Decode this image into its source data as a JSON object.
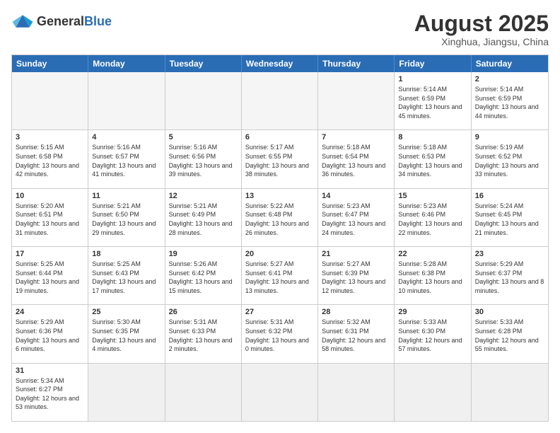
{
  "header": {
    "logo_general": "General",
    "logo_blue": "Blue",
    "month_year": "August 2025",
    "location": "Xinghua, Jiangsu, China"
  },
  "days_of_week": [
    "Sunday",
    "Monday",
    "Tuesday",
    "Wednesday",
    "Thursday",
    "Friday",
    "Saturday"
  ],
  "weeks": [
    [
      {
        "day": "",
        "info": "",
        "empty": true
      },
      {
        "day": "",
        "info": "",
        "empty": true
      },
      {
        "day": "",
        "info": "",
        "empty": true
      },
      {
        "day": "",
        "info": "",
        "empty": true
      },
      {
        "day": "",
        "info": "",
        "empty": true
      },
      {
        "day": "1",
        "info": "Sunrise: 5:14 AM\nSunset: 6:59 PM\nDaylight: 13 hours and 45 minutes.",
        "empty": false
      },
      {
        "day": "2",
        "info": "Sunrise: 5:14 AM\nSunset: 6:59 PM\nDaylight: 13 hours and 44 minutes.",
        "empty": false
      }
    ],
    [
      {
        "day": "3",
        "info": "Sunrise: 5:15 AM\nSunset: 6:58 PM\nDaylight: 13 hours and 42 minutes.",
        "empty": false
      },
      {
        "day": "4",
        "info": "Sunrise: 5:16 AM\nSunset: 6:57 PM\nDaylight: 13 hours and 41 minutes.",
        "empty": false
      },
      {
        "day": "5",
        "info": "Sunrise: 5:16 AM\nSunset: 6:56 PM\nDaylight: 13 hours and 39 minutes.",
        "empty": false
      },
      {
        "day": "6",
        "info": "Sunrise: 5:17 AM\nSunset: 6:55 PM\nDaylight: 13 hours and 38 minutes.",
        "empty": false
      },
      {
        "day": "7",
        "info": "Sunrise: 5:18 AM\nSunset: 6:54 PM\nDaylight: 13 hours and 36 minutes.",
        "empty": false
      },
      {
        "day": "8",
        "info": "Sunrise: 5:18 AM\nSunset: 6:53 PM\nDaylight: 13 hours and 34 minutes.",
        "empty": false
      },
      {
        "day": "9",
        "info": "Sunrise: 5:19 AM\nSunset: 6:52 PM\nDaylight: 13 hours and 33 minutes.",
        "empty": false
      }
    ],
    [
      {
        "day": "10",
        "info": "Sunrise: 5:20 AM\nSunset: 6:51 PM\nDaylight: 13 hours and 31 minutes.",
        "empty": false
      },
      {
        "day": "11",
        "info": "Sunrise: 5:21 AM\nSunset: 6:50 PM\nDaylight: 13 hours and 29 minutes.",
        "empty": false
      },
      {
        "day": "12",
        "info": "Sunrise: 5:21 AM\nSunset: 6:49 PM\nDaylight: 13 hours and 28 minutes.",
        "empty": false
      },
      {
        "day": "13",
        "info": "Sunrise: 5:22 AM\nSunset: 6:48 PM\nDaylight: 13 hours and 26 minutes.",
        "empty": false
      },
      {
        "day": "14",
        "info": "Sunrise: 5:23 AM\nSunset: 6:47 PM\nDaylight: 13 hours and 24 minutes.",
        "empty": false
      },
      {
        "day": "15",
        "info": "Sunrise: 5:23 AM\nSunset: 6:46 PM\nDaylight: 13 hours and 22 minutes.",
        "empty": false
      },
      {
        "day": "16",
        "info": "Sunrise: 5:24 AM\nSunset: 6:45 PM\nDaylight: 13 hours and 21 minutes.",
        "empty": false
      }
    ],
    [
      {
        "day": "17",
        "info": "Sunrise: 5:25 AM\nSunset: 6:44 PM\nDaylight: 13 hours and 19 minutes.",
        "empty": false
      },
      {
        "day": "18",
        "info": "Sunrise: 5:25 AM\nSunset: 6:43 PM\nDaylight: 13 hours and 17 minutes.",
        "empty": false
      },
      {
        "day": "19",
        "info": "Sunrise: 5:26 AM\nSunset: 6:42 PM\nDaylight: 13 hours and 15 minutes.",
        "empty": false
      },
      {
        "day": "20",
        "info": "Sunrise: 5:27 AM\nSunset: 6:41 PM\nDaylight: 13 hours and 13 minutes.",
        "empty": false
      },
      {
        "day": "21",
        "info": "Sunrise: 5:27 AM\nSunset: 6:39 PM\nDaylight: 13 hours and 12 minutes.",
        "empty": false
      },
      {
        "day": "22",
        "info": "Sunrise: 5:28 AM\nSunset: 6:38 PM\nDaylight: 13 hours and 10 minutes.",
        "empty": false
      },
      {
        "day": "23",
        "info": "Sunrise: 5:29 AM\nSunset: 6:37 PM\nDaylight: 13 hours and 8 minutes.",
        "empty": false
      }
    ],
    [
      {
        "day": "24",
        "info": "Sunrise: 5:29 AM\nSunset: 6:36 PM\nDaylight: 13 hours and 6 minutes.",
        "empty": false
      },
      {
        "day": "25",
        "info": "Sunrise: 5:30 AM\nSunset: 6:35 PM\nDaylight: 13 hours and 4 minutes.",
        "empty": false
      },
      {
        "day": "26",
        "info": "Sunrise: 5:31 AM\nSunset: 6:33 PM\nDaylight: 13 hours and 2 minutes.",
        "empty": false
      },
      {
        "day": "27",
        "info": "Sunrise: 5:31 AM\nSunset: 6:32 PM\nDaylight: 13 hours and 0 minutes.",
        "empty": false
      },
      {
        "day": "28",
        "info": "Sunrise: 5:32 AM\nSunset: 6:31 PM\nDaylight: 12 hours and 58 minutes.",
        "empty": false
      },
      {
        "day": "29",
        "info": "Sunrise: 5:33 AM\nSunset: 6:30 PM\nDaylight: 12 hours and 57 minutes.",
        "empty": false
      },
      {
        "day": "30",
        "info": "Sunrise: 5:33 AM\nSunset: 6:28 PM\nDaylight: 12 hours and 55 minutes.",
        "empty": false
      }
    ],
    [
      {
        "day": "31",
        "info": "Sunrise: 5:34 AM\nSunset: 6:27 PM\nDaylight: 12 hours and 53 minutes.",
        "empty": false
      },
      {
        "day": "",
        "info": "",
        "empty": true
      },
      {
        "day": "",
        "info": "",
        "empty": true
      },
      {
        "day": "",
        "info": "",
        "empty": true
      },
      {
        "day": "",
        "info": "",
        "empty": true
      },
      {
        "day": "",
        "info": "",
        "empty": true
      },
      {
        "day": "",
        "info": "",
        "empty": true
      }
    ]
  ]
}
